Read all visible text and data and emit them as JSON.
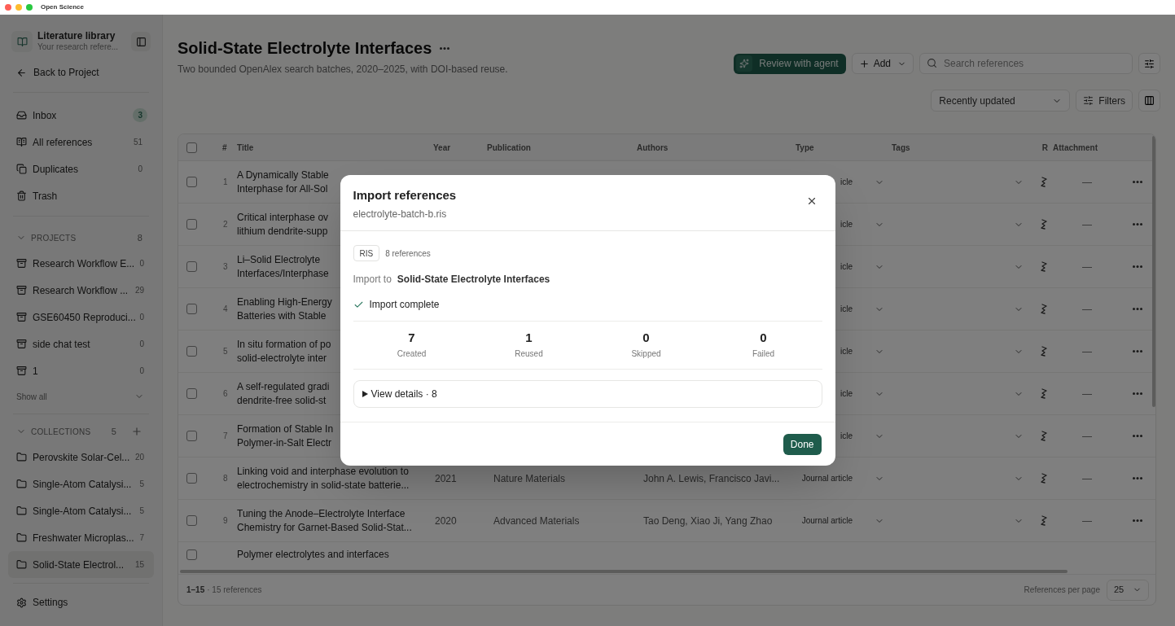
{
  "window": {
    "title": "Open Science"
  },
  "sidebar": {
    "title": "Literature library",
    "subtitle": "Your research refere...",
    "back_link": "Back to Project",
    "nav": [
      {
        "kind": "inbox",
        "label": "Inbox",
        "count": "3",
        "highlight": true
      },
      {
        "kind": "book",
        "label": "All references",
        "count": "51",
        "highlight": false
      },
      {
        "kind": "copy",
        "label": "Duplicates",
        "count": "0",
        "highlight": false
      },
      {
        "kind": "trash",
        "label": "Trash"
      }
    ],
    "projects": {
      "label": "PROJECTS",
      "count": "8",
      "expanded": true,
      "show_all": "Show all",
      "items": [
        {
          "label": "Research Workflow E...",
          "count": "0"
        },
        {
          "label": "Research Workflow ...",
          "count": "29"
        },
        {
          "label": "GSE60450 Reproduci...",
          "count": "0"
        },
        {
          "label": "side chat test",
          "count": "0"
        },
        {
          "label": "1",
          "count": "0"
        }
      ]
    },
    "collections": {
      "label": "COLLECTIONS",
      "count": "5",
      "expanded": true,
      "items": [
        {
          "label": "Perovskite Solar-Cel...",
          "count": "20",
          "selected": false
        },
        {
          "label": "Single-Atom Catalysi...",
          "count": "5",
          "selected": false
        },
        {
          "label": "Single-Atom Catalysi...",
          "count": "5",
          "selected": false
        },
        {
          "label": "Freshwater Microplas...",
          "count": "7",
          "selected": false
        },
        {
          "label": "Solid-State Electrol...",
          "count": "15",
          "selected": true
        }
      ]
    },
    "settings": "Settings"
  },
  "header": {
    "title": "Solid-State Electrolyte Interfaces",
    "subtitle": "Two bounded OpenAlex search batches, 2020–2025, with DOI-based reuse.",
    "review_button": "Review with agent",
    "add_button": "Add",
    "search": {
      "placeholder": "Search references"
    },
    "sort": "Recently updated",
    "filters": "Filters"
  },
  "table": {
    "select_all_checked": false,
    "columns": [
      "#",
      "Title",
      "Year",
      "Publication",
      "Authors",
      "Type",
      "Tags",
      "R",
      "Attachment"
    ],
    "rows": [
      {
        "number": "1",
        "title_lines": [
          "A Dynamically Stable",
          "Interphase for All-Sol"
        ],
        "type": "icle",
        "attachment": "—",
        "checked": false
      },
      {
        "number": "2",
        "title_lines": [
          "Critical interphase ov",
          "lithium dendrite-supp"
        ],
        "type": "icle",
        "attachment": "—",
        "checked": false
      },
      {
        "number": "3",
        "title_lines": [
          "Li–Solid Electrolyte",
          "Interfaces/Interphase"
        ],
        "type": "icle",
        "attachment": "—",
        "checked": false
      },
      {
        "number": "4",
        "title_lines": [
          "Enabling High-Energy",
          "Batteries with Stable"
        ],
        "type": "icle",
        "attachment": "—",
        "checked": false
      },
      {
        "number": "5",
        "title_lines": [
          "In situ formation of po",
          "solid-electrolyte inter"
        ],
        "type": "icle",
        "attachment": "—",
        "checked": false
      },
      {
        "number": "6",
        "title_lines": [
          "A self-regulated gradi",
          "dendrite-free solid-st"
        ],
        "type": "icle",
        "attachment": "—",
        "checked": false
      },
      {
        "number": "7",
        "title_lines": [
          "Formation of Stable In",
          "Polymer-in-Salt Electr"
        ],
        "type": "icle",
        "attachment": "—",
        "checked": false
      },
      {
        "number": "8",
        "title_lines": [
          "Linking void and interphase evolution to",
          "electrochemistry in solid-state batterie..."
        ],
        "year": "2021",
        "publication": "Nature Materials",
        "authors": "John A. Lewis, Francisco Javi...",
        "type": "Journal article",
        "attachment": "—",
        "checked": false
      },
      {
        "number": "9",
        "title_lines": [
          "Tuning the Anode–Electrolyte Interface",
          "Chemistry for Garnet-Based Solid-Stat..."
        ],
        "year": "2020",
        "publication": "Advanced Materials",
        "authors": "Tao Deng, Xiao Ji, Yang Zhao",
        "type": "Journal article",
        "attachment": "—",
        "checked": false
      }
    ],
    "partial_row": {
      "title": "Polymer electrolytes and interfaces",
      "checked": false
    },
    "footer": {
      "range": "1–15",
      "total": "· 15 references",
      "per_page_label": "References per page",
      "per_page": "25"
    }
  },
  "dialog": {
    "title": "Import references",
    "filename": "electrolyte-batch-b.ris",
    "format": "RIS",
    "count": "8 references",
    "import_to_label": "Import to",
    "import_to": "Solid-State Electrolyte Interfaces",
    "status": "Import complete",
    "complete": true,
    "stats": [
      {
        "value": "7",
        "label": "Created"
      },
      {
        "value": "1",
        "label": "Reused"
      },
      {
        "value": "0",
        "label": "Skipped"
      },
      {
        "value": "0",
        "label": "Failed"
      }
    ],
    "details": "View details · 8",
    "details_expanded": false,
    "done_button": "Done"
  }
}
